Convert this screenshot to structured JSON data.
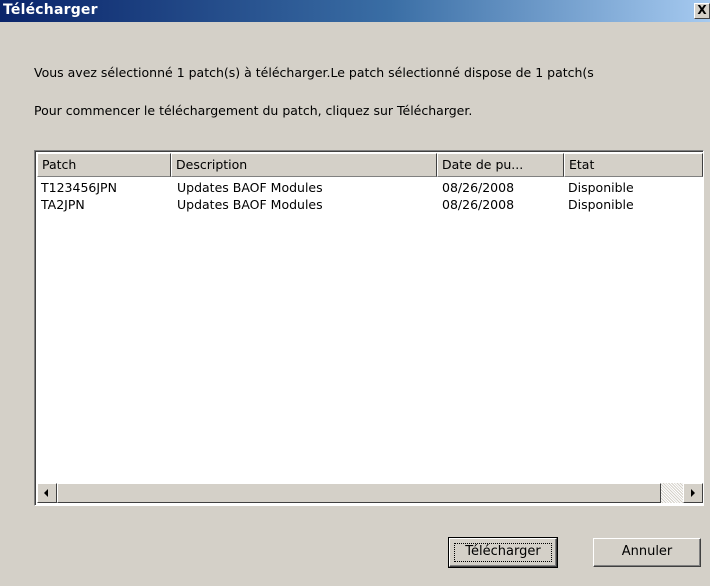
{
  "window": {
    "title": "Télécharger",
    "close_label": "X"
  },
  "messages": {
    "line1": "Vous avez sélectionné 1 patch(s) à télécharger.Le patch sélectionné dispose de 1 patch(s",
    "line2": "Pour commencer le téléchargement du patch, cliquez sur Télécharger."
  },
  "table": {
    "columns": [
      "Patch",
      "Description",
      "Date de pu...",
      "Etat"
    ],
    "rows": [
      [
        "T123456JPN",
        "Updates BAOF Modules",
        "08/26/2008",
        "Disponible"
      ],
      [
        "TA2JPN",
        "Updates BAOF Modules",
        "08/26/2008",
        "Disponible"
      ]
    ]
  },
  "buttons": {
    "download_label": "Télécharger",
    "cancel_label": "Annuler"
  },
  "colors": {
    "titlebar_start": "#0a246a",
    "titlebar_end": "#a6caf0",
    "dialog_bg": "#d4d0c8"
  },
  "icons": {
    "scroll_left": "scroll-left-icon",
    "scroll_right": "scroll-right-icon"
  }
}
